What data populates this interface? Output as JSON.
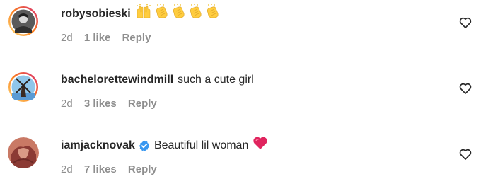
{
  "comments": [
    {
      "username": "robysobieski",
      "text": "",
      "emoji": [
        "raising-hands-icon",
        "clapping-hands-icon",
        "clapping-hands-icon",
        "clapping-hands-icon",
        "clapping-hands-icon"
      ],
      "time": "2d",
      "likes": "1 like",
      "reply": "Reply",
      "verified": false
    },
    {
      "username": "bachelorettewindmill",
      "text": "such a cute girl",
      "emoji": [],
      "time": "2d",
      "likes": "3 likes",
      "reply": "Reply",
      "verified": false
    },
    {
      "username": "iamjacknovak",
      "text": "Beautiful lil woman",
      "emoji": [
        "red-heart-icon"
      ],
      "time": "2d",
      "likes": "7 likes",
      "reply": "Reply",
      "verified": true
    }
  ],
  "colors": {
    "text": "#262626",
    "secondary": "#8e8e8e",
    "verified_blue": "#3897f0",
    "heart_red": "#e0245e",
    "story_ring_start": "#feda75",
    "story_ring_end": "#d62976"
  }
}
